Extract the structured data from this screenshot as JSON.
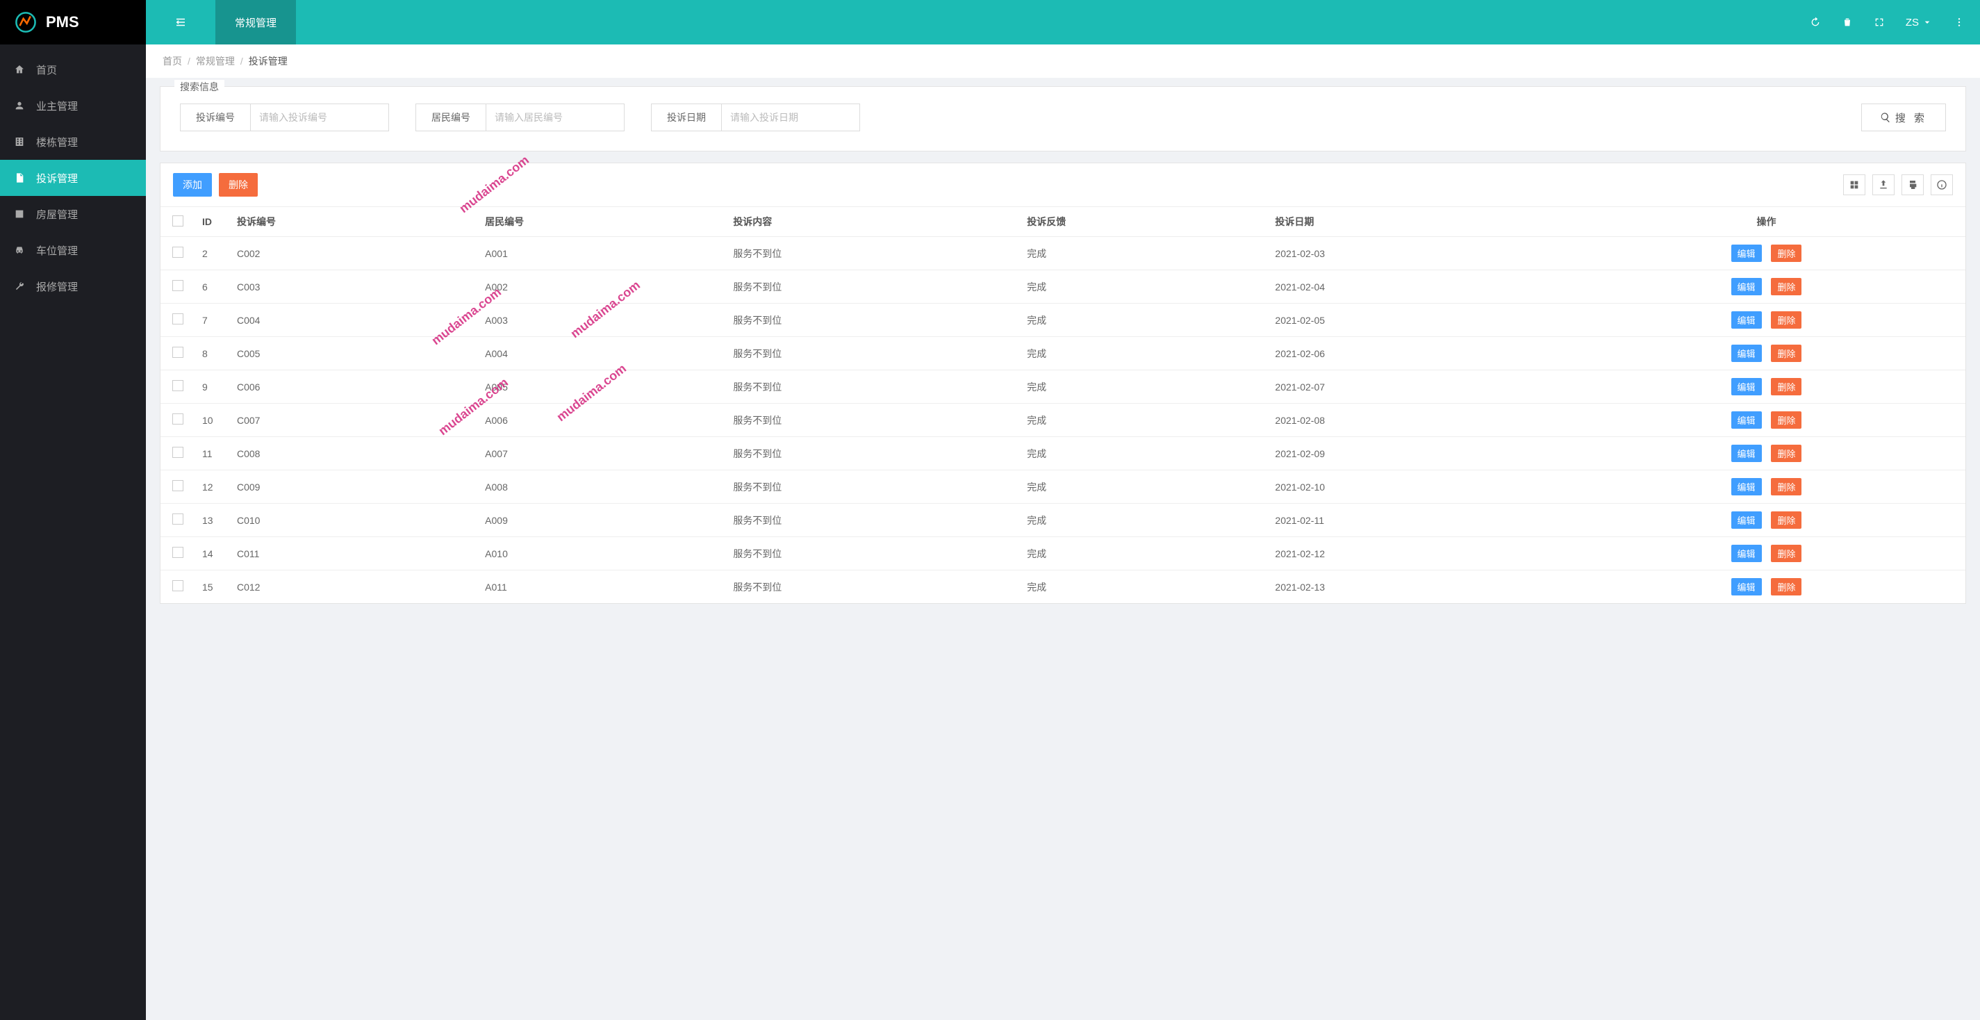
{
  "brand": "PMS",
  "sidebar": {
    "items": [
      {
        "label": "首页",
        "icon": "home"
      },
      {
        "label": "业主管理",
        "icon": "user"
      },
      {
        "label": "楼栋管理",
        "icon": "building"
      },
      {
        "label": "投诉管理",
        "icon": "file",
        "active": true
      },
      {
        "label": "房屋管理",
        "icon": "room"
      },
      {
        "label": "车位管理",
        "icon": "car"
      },
      {
        "label": "报修管理",
        "icon": "wrench"
      }
    ]
  },
  "topbar": {
    "tab_label": "常规管理",
    "user": "ZS"
  },
  "breadcrumb": {
    "items": [
      "首页",
      "常规管理",
      "投诉管理"
    ]
  },
  "search": {
    "legend": "搜索信息",
    "groups": [
      {
        "label": "投诉编号",
        "placeholder": "请输入投诉编号"
      },
      {
        "label": "居民编号",
        "placeholder": "请输入居民编号"
      },
      {
        "label": "投诉日期",
        "placeholder": "请输入投诉日期"
      }
    ],
    "button": "搜 索"
  },
  "toolbar": {
    "add": "添加",
    "delete": "删除"
  },
  "table": {
    "headers": {
      "id": "ID",
      "complaint_no": "投诉编号",
      "resident_no": "居民编号",
      "content": "投诉内容",
      "feedback": "投诉反馈",
      "date": "投诉日期",
      "actions": "操作"
    },
    "action_labels": {
      "edit": "编辑",
      "delete": "删除"
    },
    "rows": [
      {
        "id": "2",
        "complaint_no": "C002",
        "resident_no": "A001",
        "content": "服务不到位",
        "feedback": "完成",
        "date": "2021-02-03"
      },
      {
        "id": "6",
        "complaint_no": "C003",
        "resident_no": "A002",
        "content": "服务不到位",
        "feedback": "完成",
        "date": "2021-02-04"
      },
      {
        "id": "7",
        "complaint_no": "C004",
        "resident_no": "A003",
        "content": "服务不到位",
        "feedback": "完成",
        "date": "2021-02-05"
      },
      {
        "id": "8",
        "complaint_no": "C005",
        "resident_no": "A004",
        "content": "服务不到位",
        "feedback": "完成",
        "date": "2021-02-06"
      },
      {
        "id": "9",
        "complaint_no": "C006",
        "resident_no": "A005",
        "content": "服务不到位",
        "feedback": "完成",
        "date": "2021-02-07"
      },
      {
        "id": "10",
        "complaint_no": "C007",
        "resident_no": "A006",
        "content": "服务不到位",
        "feedback": "完成",
        "date": "2021-02-08"
      },
      {
        "id": "11",
        "complaint_no": "C008",
        "resident_no": "A007",
        "content": "服务不到位",
        "feedback": "完成",
        "date": "2021-02-09"
      },
      {
        "id": "12",
        "complaint_no": "C009",
        "resident_no": "A008",
        "content": "服务不到位",
        "feedback": "完成",
        "date": "2021-02-10"
      },
      {
        "id": "13",
        "complaint_no": "C010",
        "resident_no": "A009",
        "content": "服务不到位",
        "feedback": "完成",
        "date": "2021-02-11"
      },
      {
        "id": "14",
        "complaint_no": "C011",
        "resident_no": "A010",
        "content": "服务不到位",
        "feedback": "完成",
        "date": "2021-02-12"
      },
      {
        "id": "15",
        "complaint_no": "C012",
        "resident_no": "A011",
        "content": "服务不到位",
        "feedback": "完成",
        "date": "2021-02-13"
      }
    ]
  },
  "watermark": "mudaima.com"
}
